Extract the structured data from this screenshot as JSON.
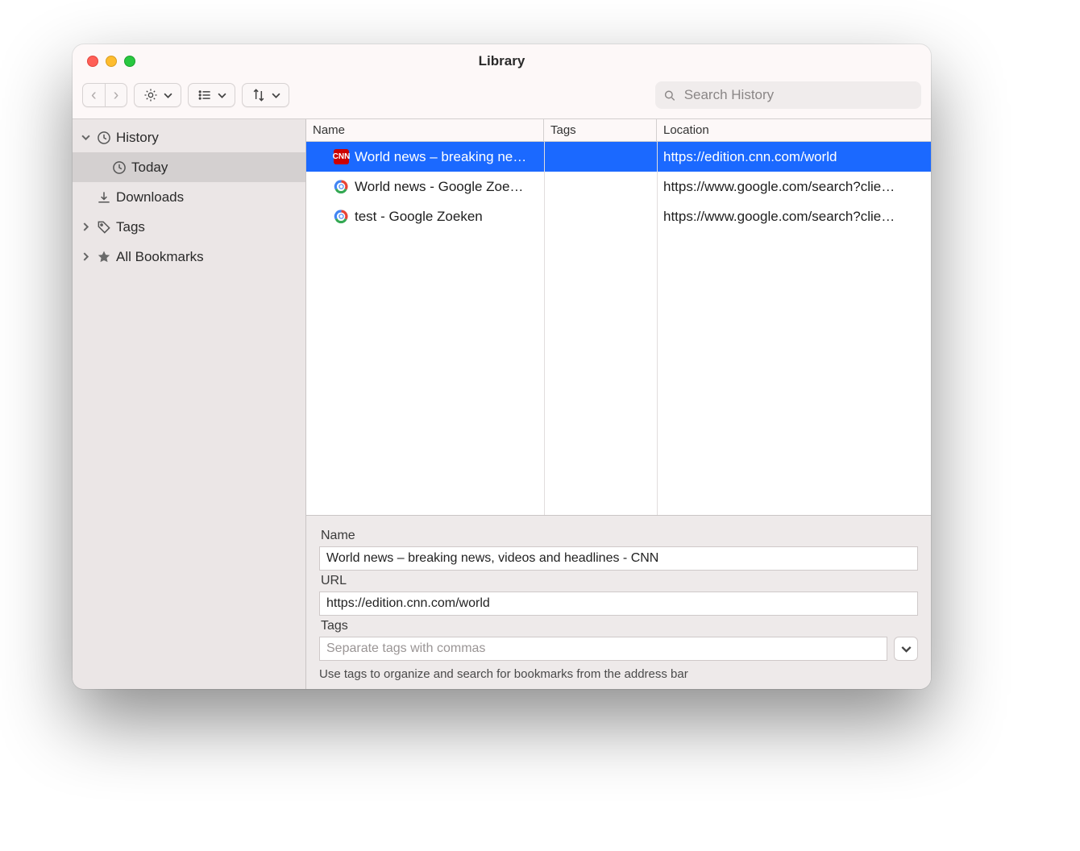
{
  "window": {
    "title": "Library"
  },
  "search": {
    "placeholder": "Search History"
  },
  "sidebar": {
    "items": [
      {
        "label": "History",
        "icon": "clock-icon",
        "expanded": true,
        "children": [
          {
            "label": "Today",
            "icon": "clock-icon",
            "selected": true
          }
        ]
      },
      {
        "label": "Downloads",
        "icon": "download-icon"
      },
      {
        "label": "Tags",
        "icon": "tag-icon",
        "expandable": true
      },
      {
        "label": "All Bookmarks",
        "icon": "star-icon",
        "expandable": true
      }
    ]
  },
  "columns": {
    "name": "Name",
    "tags": "Tags",
    "location": "Location"
  },
  "rows": [
    {
      "name": "World news – breaking ne…",
      "location": "https://edition.cnn.com/world",
      "favicon": "cnn",
      "selected": true
    },
    {
      "name": "World news - Google Zoe…",
      "location": "https://www.google.com/search?clie…",
      "favicon": "google",
      "selected": false
    },
    {
      "name": "test - Google Zoeken",
      "location": "https://www.google.com/search?clie…",
      "favicon": "google",
      "selected": false
    }
  ],
  "details": {
    "name_label": "Name",
    "name_value": "World news – breaking news, videos and headlines - CNN",
    "url_label": "URL",
    "url_value": "https://edition.cnn.com/world",
    "tags_label": "Tags",
    "tags_placeholder": "Separate tags with commas",
    "hint": "Use tags to organize and search for bookmarks from the address bar"
  }
}
